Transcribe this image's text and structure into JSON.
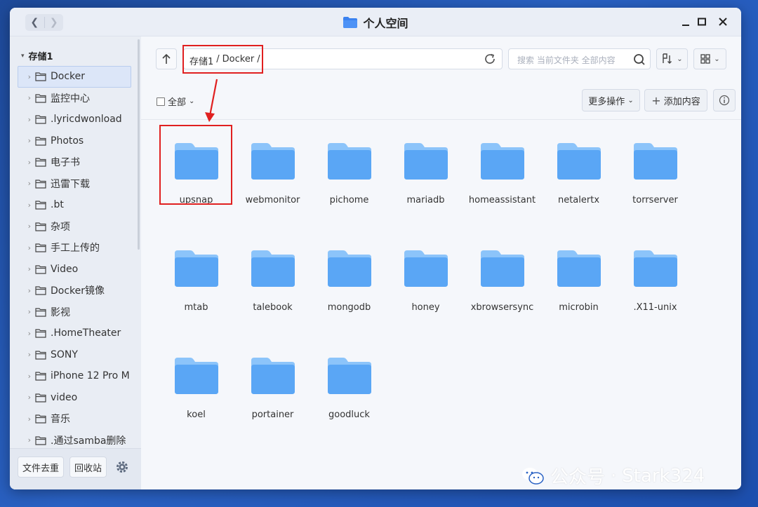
{
  "window": {
    "title": "个人空间"
  },
  "sidebar": {
    "root": "存储1",
    "items": [
      {
        "label": "Docker",
        "active": true
      },
      {
        "label": "监控中心"
      },
      {
        "label": ".lyricdwonload"
      },
      {
        "label": "Photos"
      },
      {
        "label": "电子书"
      },
      {
        "label": "迅雷下载"
      },
      {
        "label": ".bt"
      },
      {
        "label": "杂项"
      },
      {
        "label": "手工上传的"
      },
      {
        "label": "Video"
      },
      {
        "label": "Docker镜像"
      },
      {
        "label": "影视"
      },
      {
        "label": ".HomeTheater"
      },
      {
        "label": "SONY"
      },
      {
        "label": "iPhone 12 Pro M"
      },
      {
        "label": "video"
      },
      {
        "label": "音乐"
      },
      {
        "label": ".通过samba删除"
      }
    ],
    "dedupe_label": "文件去重",
    "recycle_label": "回收站"
  },
  "toolbar": {
    "breadcrumb": [
      "存储1",
      "/",
      "Docker",
      "/"
    ],
    "search_placeholder": "搜索 当前文件夹 全部内容",
    "select_all_label": "全部",
    "more_actions_label": "更多操作",
    "add_content_label": "添加内容"
  },
  "folders": [
    "upsnap",
    "webmonitor",
    "pichome",
    "mariadb",
    "homeassistant",
    "netalertx",
    "torrserver",
    "mtab",
    "talebook",
    "mongodb",
    "honey",
    "xbrowsersync",
    "microbin",
    ".X11-unix",
    "koel",
    "portainer",
    "goodluck"
  ],
  "watermark": {
    "prefix": "公众号",
    "dot": "·",
    "name": "Stark324"
  },
  "colors": {
    "folder_front": "#5aa6f5",
    "folder_back": "#8cc4fa",
    "highlight": "#e02020",
    "brand_bg": "#2a62c4"
  }
}
